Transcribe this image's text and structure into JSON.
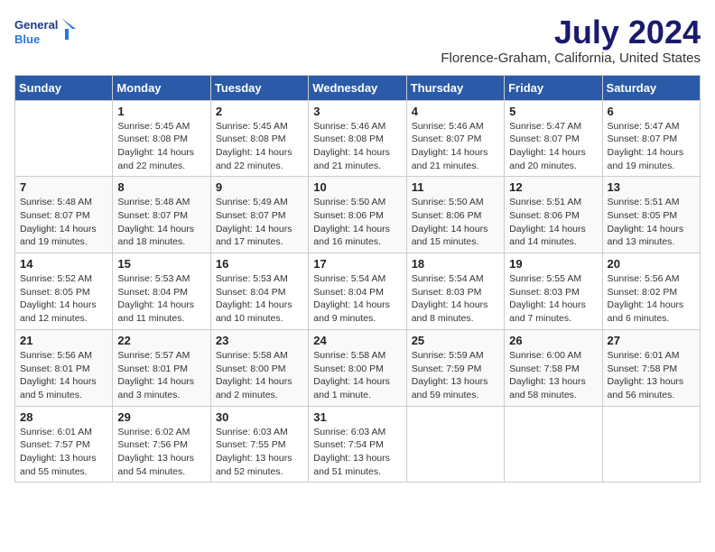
{
  "logo": {
    "line1": "General",
    "line2": "Blue"
  },
  "title": "July 2024",
  "location": "Florence-Graham, California, United States",
  "days_of_week": [
    "Sunday",
    "Monday",
    "Tuesday",
    "Wednesday",
    "Thursday",
    "Friday",
    "Saturday"
  ],
  "weeks": [
    [
      {
        "day": "",
        "info": ""
      },
      {
        "day": "1",
        "info": "Sunrise: 5:45 AM\nSunset: 8:08 PM\nDaylight: 14 hours\nand 22 minutes."
      },
      {
        "day": "2",
        "info": "Sunrise: 5:45 AM\nSunset: 8:08 PM\nDaylight: 14 hours\nand 22 minutes."
      },
      {
        "day": "3",
        "info": "Sunrise: 5:46 AM\nSunset: 8:08 PM\nDaylight: 14 hours\nand 21 minutes."
      },
      {
        "day": "4",
        "info": "Sunrise: 5:46 AM\nSunset: 8:07 PM\nDaylight: 14 hours\nand 21 minutes."
      },
      {
        "day": "5",
        "info": "Sunrise: 5:47 AM\nSunset: 8:07 PM\nDaylight: 14 hours\nand 20 minutes."
      },
      {
        "day": "6",
        "info": "Sunrise: 5:47 AM\nSunset: 8:07 PM\nDaylight: 14 hours\nand 19 minutes."
      }
    ],
    [
      {
        "day": "7",
        "info": "Sunrise: 5:48 AM\nSunset: 8:07 PM\nDaylight: 14 hours\nand 19 minutes."
      },
      {
        "day": "8",
        "info": "Sunrise: 5:48 AM\nSunset: 8:07 PM\nDaylight: 14 hours\nand 18 minutes."
      },
      {
        "day": "9",
        "info": "Sunrise: 5:49 AM\nSunset: 8:07 PM\nDaylight: 14 hours\nand 17 minutes."
      },
      {
        "day": "10",
        "info": "Sunrise: 5:50 AM\nSunset: 8:06 PM\nDaylight: 14 hours\nand 16 minutes."
      },
      {
        "day": "11",
        "info": "Sunrise: 5:50 AM\nSunset: 8:06 PM\nDaylight: 14 hours\nand 15 minutes."
      },
      {
        "day": "12",
        "info": "Sunrise: 5:51 AM\nSunset: 8:06 PM\nDaylight: 14 hours\nand 14 minutes."
      },
      {
        "day": "13",
        "info": "Sunrise: 5:51 AM\nSunset: 8:05 PM\nDaylight: 14 hours\nand 13 minutes."
      }
    ],
    [
      {
        "day": "14",
        "info": "Sunrise: 5:52 AM\nSunset: 8:05 PM\nDaylight: 14 hours\nand 12 minutes."
      },
      {
        "day": "15",
        "info": "Sunrise: 5:53 AM\nSunset: 8:04 PM\nDaylight: 14 hours\nand 11 minutes."
      },
      {
        "day": "16",
        "info": "Sunrise: 5:53 AM\nSunset: 8:04 PM\nDaylight: 14 hours\nand 10 minutes."
      },
      {
        "day": "17",
        "info": "Sunrise: 5:54 AM\nSunset: 8:04 PM\nDaylight: 14 hours\nand 9 minutes."
      },
      {
        "day": "18",
        "info": "Sunrise: 5:54 AM\nSunset: 8:03 PM\nDaylight: 14 hours\nand 8 minutes."
      },
      {
        "day": "19",
        "info": "Sunrise: 5:55 AM\nSunset: 8:03 PM\nDaylight: 14 hours\nand 7 minutes."
      },
      {
        "day": "20",
        "info": "Sunrise: 5:56 AM\nSunset: 8:02 PM\nDaylight: 14 hours\nand 6 minutes."
      }
    ],
    [
      {
        "day": "21",
        "info": "Sunrise: 5:56 AM\nSunset: 8:01 PM\nDaylight: 14 hours\nand 5 minutes."
      },
      {
        "day": "22",
        "info": "Sunrise: 5:57 AM\nSunset: 8:01 PM\nDaylight: 14 hours\nand 3 minutes."
      },
      {
        "day": "23",
        "info": "Sunrise: 5:58 AM\nSunset: 8:00 PM\nDaylight: 14 hours\nand 2 minutes."
      },
      {
        "day": "24",
        "info": "Sunrise: 5:58 AM\nSunset: 8:00 PM\nDaylight: 14 hours\nand 1 minute."
      },
      {
        "day": "25",
        "info": "Sunrise: 5:59 AM\nSunset: 7:59 PM\nDaylight: 13 hours\nand 59 minutes."
      },
      {
        "day": "26",
        "info": "Sunrise: 6:00 AM\nSunset: 7:58 PM\nDaylight: 13 hours\nand 58 minutes."
      },
      {
        "day": "27",
        "info": "Sunrise: 6:01 AM\nSunset: 7:58 PM\nDaylight: 13 hours\nand 56 minutes."
      }
    ],
    [
      {
        "day": "28",
        "info": "Sunrise: 6:01 AM\nSunset: 7:57 PM\nDaylight: 13 hours\nand 55 minutes."
      },
      {
        "day": "29",
        "info": "Sunrise: 6:02 AM\nSunset: 7:56 PM\nDaylight: 13 hours\nand 54 minutes."
      },
      {
        "day": "30",
        "info": "Sunrise: 6:03 AM\nSunset: 7:55 PM\nDaylight: 13 hours\nand 52 minutes."
      },
      {
        "day": "31",
        "info": "Sunrise: 6:03 AM\nSunset: 7:54 PM\nDaylight: 13 hours\nand 51 minutes."
      },
      {
        "day": "",
        "info": ""
      },
      {
        "day": "",
        "info": ""
      },
      {
        "day": "",
        "info": ""
      }
    ]
  ]
}
